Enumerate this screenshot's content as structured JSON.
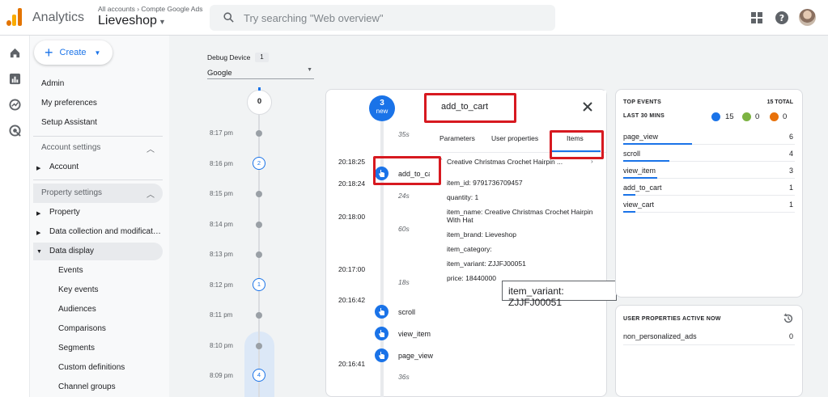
{
  "header": {
    "app_title": "Analytics",
    "breadcrumb": "All accounts › Compte Google Ads",
    "property_name": "Lieveshop",
    "search_placeholder": "Try searching \"Web overview\""
  },
  "sidebar": {
    "create_label": "Create",
    "top_items": [
      "Admin",
      "My preferences",
      "Setup Assistant"
    ],
    "account_settings_label": "Account settings",
    "account_item": "Account",
    "property_settings_label": "Property settings",
    "property_items": [
      "Property",
      "Data collection and modificat…",
      "Data display"
    ],
    "data_display_items": [
      "Events",
      "Key events",
      "Audiences",
      "Comparisons",
      "Segments",
      "Custom definitions",
      "Channel groups"
    ]
  },
  "debug": {
    "device_label": "Debug Device",
    "device_count": "1",
    "device_value": "Google"
  },
  "minute_stream": {
    "top_count": "0",
    "rows": [
      {
        "time": "8:17 pm",
        "count": ""
      },
      {
        "time": "8:16 pm",
        "count": "2"
      },
      {
        "time": "8:15 pm",
        "count": ""
      },
      {
        "time": "8:14 pm",
        "count": ""
      },
      {
        "time": "8:13 pm",
        "count": ""
      },
      {
        "time": "8:12 pm",
        "count": "1"
      },
      {
        "time": "8:11 pm",
        "count": ""
      },
      {
        "time": "8:10 pm",
        "count": ""
      },
      {
        "time": "8:09 pm",
        "count": "4"
      }
    ]
  },
  "seconds_stream": {
    "new_count": "3",
    "new_label": "new",
    "gaps": [
      "35s",
      "24s",
      "60s",
      "18s",
      "36s"
    ],
    "times": [
      "20:18:25",
      "20:18:24",
      "20:18:00",
      "20:17:00",
      "20:16:42",
      "20:16:41"
    ],
    "events": [
      "add_to_ca",
      "scroll",
      "view_item",
      "page_view"
    ]
  },
  "event_detail": {
    "title": "add_to_cart",
    "tabs": [
      "Parameters",
      "User properties",
      "Items"
    ],
    "active_tab": "Items",
    "item_title": "Creative Christmas Crochet Hairpin ...",
    "item_fields": [
      "item_id: 9791736709457",
      "quantity: 1",
      "item_name: Creative Christmas Crochet Hairpin With Hat",
      "item_brand: Lieveshop",
      "item_category:",
      "item_variant: ZJJFJ00051",
      "price: 18440000"
    ],
    "tooltip": "item_variant: ZJJFJ00051"
  },
  "top_events": {
    "header": "TOP EVENTS",
    "total_label": "15 TOTAL",
    "period_label": "LAST 30 MINS",
    "legend": [
      {
        "count": "15",
        "color": "#1a73e8"
      },
      {
        "count": "0",
        "color": "#7cb342"
      },
      {
        "count": "0",
        "color": "#e8710a"
      }
    ],
    "rows": [
      {
        "name": "page_view",
        "count": "6",
        "share": 0.4
      },
      {
        "name": "scroll",
        "count": "4",
        "share": 0.27
      },
      {
        "name": "view_item",
        "count": "3",
        "share": 0.2
      },
      {
        "name": "add_to_cart",
        "count": "1",
        "share": 0.07
      },
      {
        "name": "view_cart",
        "count": "1",
        "share": 0.07
      }
    ]
  },
  "user_properties": {
    "header": "USER PROPERTIES ACTIVE NOW",
    "rows": [
      {
        "name": "non_personalized_ads",
        "count": "0"
      }
    ]
  },
  "colors": {
    "accent": "#1a73e8",
    "annotation_red": "#d71920"
  }
}
